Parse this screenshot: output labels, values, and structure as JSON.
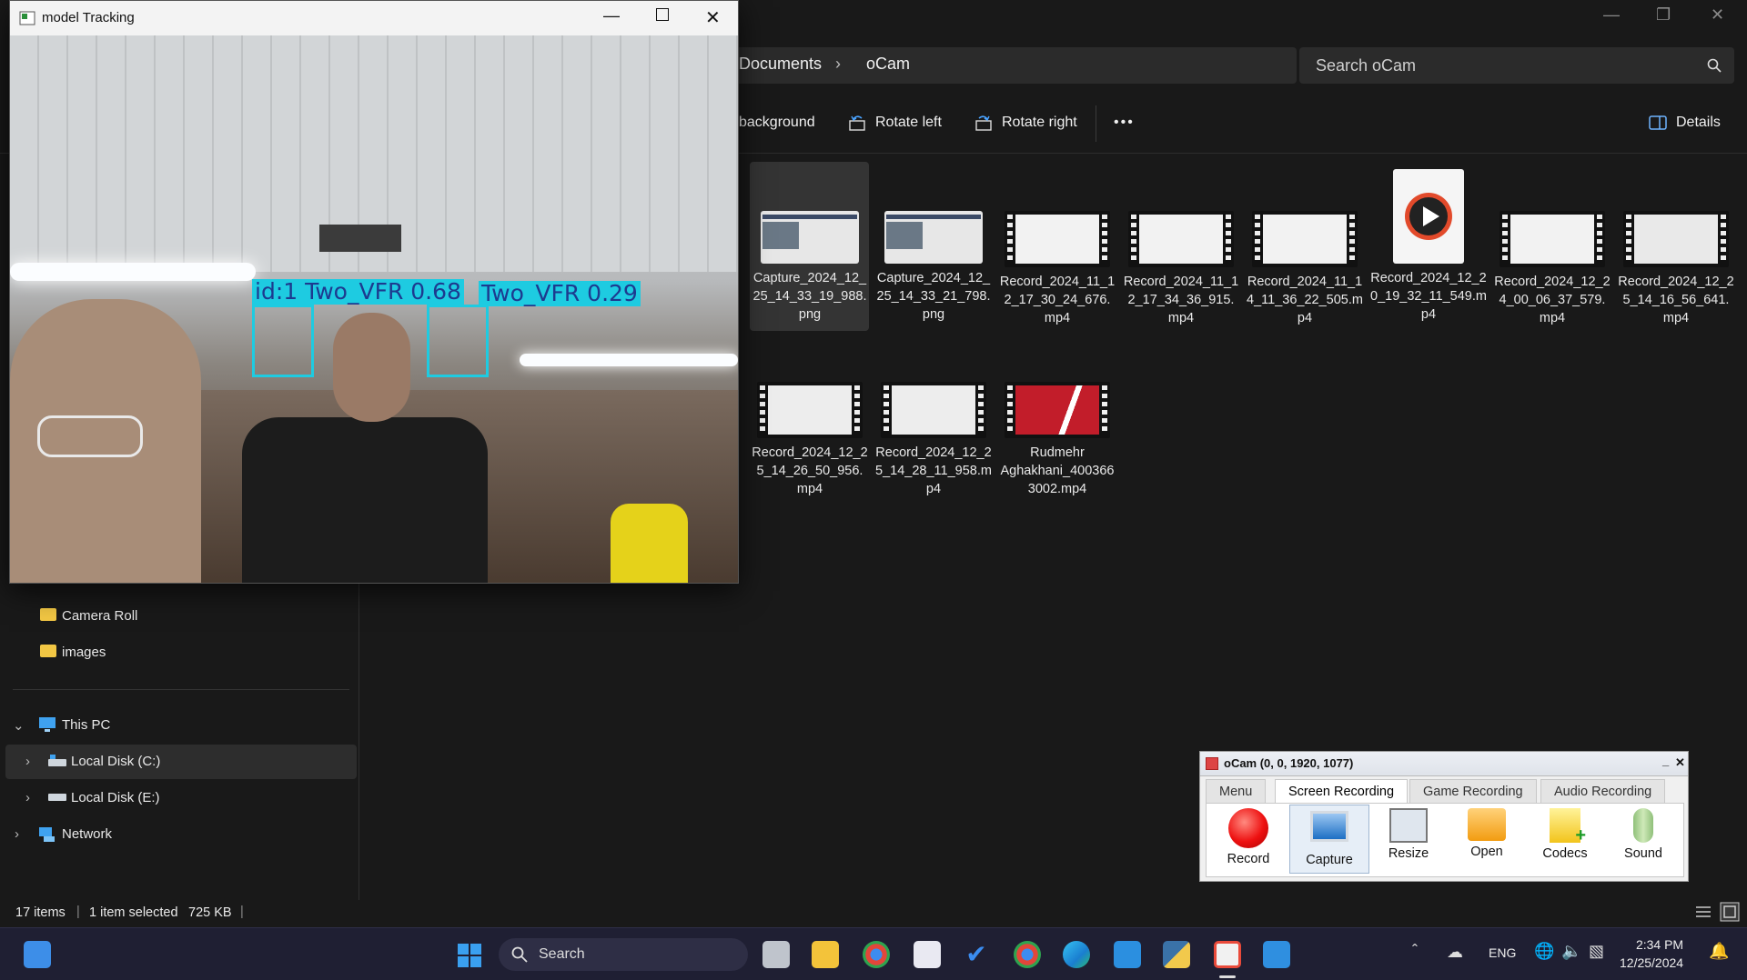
{
  "explorer": {
    "breadcrumb": [
      "Documents",
      "oCam"
    ],
    "search_placeholder": "Search oCam",
    "toolbar": {
      "background_label": "background",
      "rotate_left_label": "Rotate left",
      "rotate_right_label": "Rotate right",
      "more_label": "•••",
      "details_label": "Details"
    },
    "files": [
      {
        "name": "Capture_2024_12_25_14_33_19_988.png",
        "kind": "png",
        "selected": true
      },
      {
        "name": "Capture_2024_12_25_14_33_21_798.png",
        "kind": "png",
        "selected": false
      },
      {
        "name": "Record_2024_11_12_17_30_24_676.mp4",
        "kind": "video",
        "selected": false
      },
      {
        "name": "Record_2024_11_12_17_34_36_915.mp4",
        "kind": "video",
        "selected": false
      },
      {
        "name": "Record_2024_11_14_11_36_22_505.mp4",
        "kind": "video",
        "selected": false
      },
      {
        "name": "Record_2024_12_20_19_32_11_549.mp4",
        "kind": "player",
        "selected": false
      },
      {
        "name": "Record_2024_12_24_00_06_37_579.mp4",
        "kind": "video",
        "selected": false
      },
      {
        "name": "Record_2024_12_25_14_16_56_641.mp4",
        "kind": "video",
        "selected": false
      },
      {
        "name": "Record_2024_12_25_14_26_50_956.mp4",
        "kind": "video",
        "selected": false
      },
      {
        "name": "Record_2024_12_25_14_28_11_958.mp4",
        "kind": "video",
        "selected": false
      },
      {
        "name": "Rudmehr Aghakhani_4003663002.mp4",
        "kind": "video-red",
        "selected": false
      }
    ],
    "sidebar": {
      "partial_item": "2",
      "folders": [
        "Camera Roll",
        "images"
      ],
      "this_pc": "This PC",
      "drives": [
        "Local Disk (C:)",
        "Local Disk (E:)"
      ],
      "network": "Network"
    },
    "status": {
      "items": "17 items",
      "selected": "1 item selected",
      "size": "725 KB"
    }
  },
  "tracking_window": {
    "title": "model Tracking",
    "detections": [
      {
        "label": "id:1  Two_VFR 0.68"
      },
      {
        "label": "Two_VFR 0.29"
      }
    ]
  },
  "ocam": {
    "title": "oCam (0, 0, 1920, 1077)",
    "tabs": [
      "Menu",
      "Screen Recording",
      "Game Recording",
      "Audio Recording"
    ],
    "selected_tab": "Screen Recording",
    "buttons": [
      "Record",
      "Capture",
      "Resize",
      "Open",
      "Codecs",
      "Sound"
    ]
  },
  "taskbar": {
    "search_label": "Search",
    "lang": "ENG",
    "time": "2:34 PM",
    "date": "12/25/2024"
  },
  "colors": {
    "accent_detection": "#1ecbe1",
    "explorer_bg": "#191919",
    "taskbar_bg": "#1f1f33"
  }
}
